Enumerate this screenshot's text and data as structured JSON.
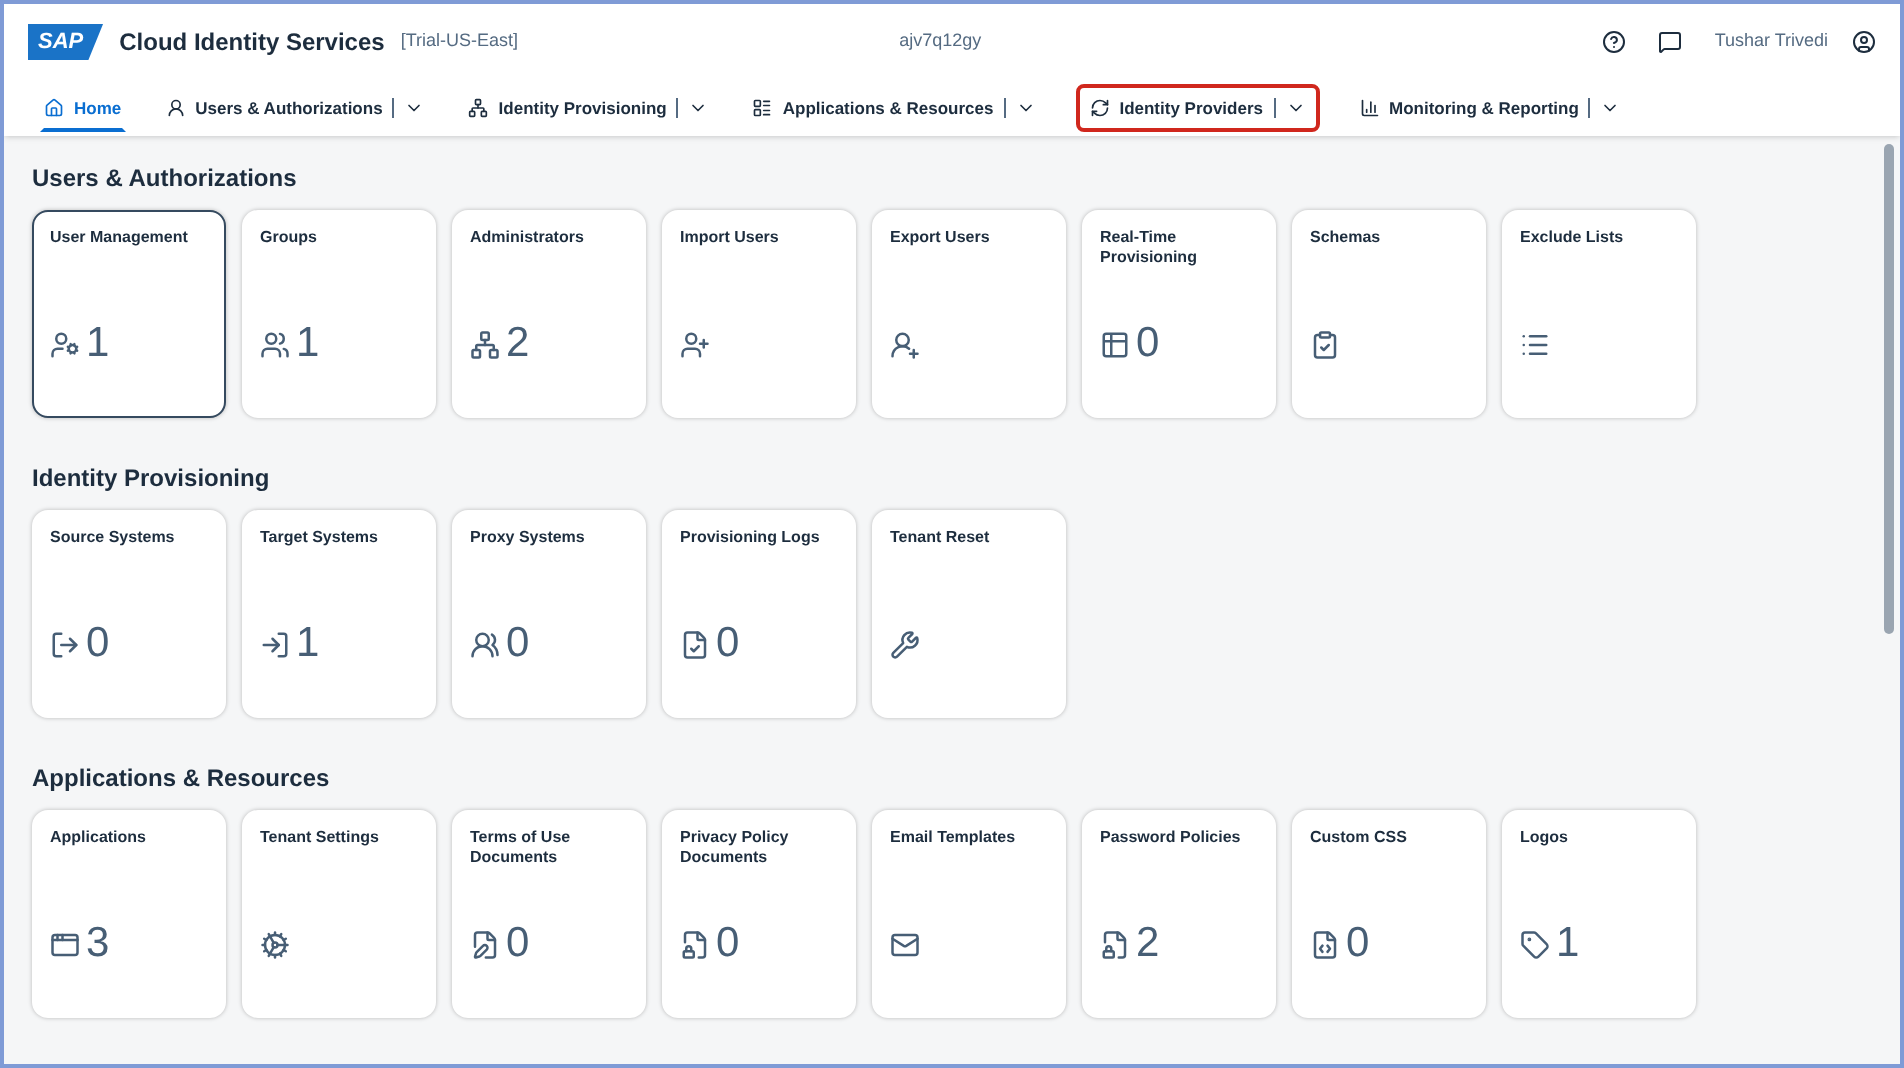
{
  "header": {
    "logo": "SAP",
    "product": "Cloud Identity Services",
    "tenant_region": "[Trial-US-East]",
    "tenant_id": "ajv7q12gy",
    "user_name": "Tushar Trivedi"
  },
  "nav": [
    {
      "label": "Home",
      "selected": true,
      "dropdown": false,
      "highlighted": false
    },
    {
      "label": "Users & Authorizations",
      "selected": false,
      "dropdown": true,
      "highlighted": false
    },
    {
      "label": "Identity Provisioning",
      "selected": false,
      "dropdown": true,
      "highlighted": false
    },
    {
      "label": "Applications & Resources",
      "selected": false,
      "dropdown": true,
      "highlighted": false
    },
    {
      "label": "Identity Providers",
      "selected": false,
      "dropdown": true,
      "highlighted": true
    },
    {
      "label": "Monitoring & Reporting",
      "selected": false,
      "dropdown": true,
      "highlighted": false
    }
  ],
  "sections": [
    {
      "title": "Users & Authorizations",
      "tiles": [
        {
          "title": "User Management",
          "count": "1",
          "selected": true
        },
        {
          "title": "Groups",
          "count": "1",
          "selected": false
        },
        {
          "title": "Administrators",
          "count": "2",
          "selected": false
        },
        {
          "title": "Import Users",
          "selected": false
        },
        {
          "title": "Export Users",
          "selected": false
        },
        {
          "title": "Real-Time Provisioning",
          "count": "0",
          "selected": false
        },
        {
          "title": "Schemas",
          "selected": false
        },
        {
          "title": "Exclude Lists",
          "selected": false
        }
      ]
    },
    {
      "title": "Identity Provisioning",
      "tiles": [
        {
          "title": "Source Systems",
          "count": "0",
          "selected": false
        },
        {
          "title": "Target Systems",
          "count": "1",
          "selected": false
        },
        {
          "title": "Proxy Systems",
          "count": "0",
          "selected": false
        },
        {
          "title": "Provisioning Logs",
          "count": "0",
          "selected": false
        },
        {
          "title": "Tenant Reset",
          "selected": false
        }
      ]
    },
    {
      "title": "Applications & Resources",
      "tiles": [
        {
          "title": "Applications",
          "count": "3",
          "selected": false
        },
        {
          "title": "Tenant Settings",
          "selected": false
        },
        {
          "title": "Terms of Use Documents",
          "count": "0",
          "selected": false
        },
        {
          "title": "Privacy Policy Documents",
          "count": "0",
          "selected": false
        },
        {
          "title": "Email Templates",
          "selected": false
        },
        {
          "title": "Password Policies",
          "count": "2",
          "selected": false
        },
        {
          "title": "Custom CSS",
          "count": "0",
          "selected": false
        },
        {
          "title": "Logos",
          "count": "1",
          "selected": false
        }
      ]
    }
  ]
}
